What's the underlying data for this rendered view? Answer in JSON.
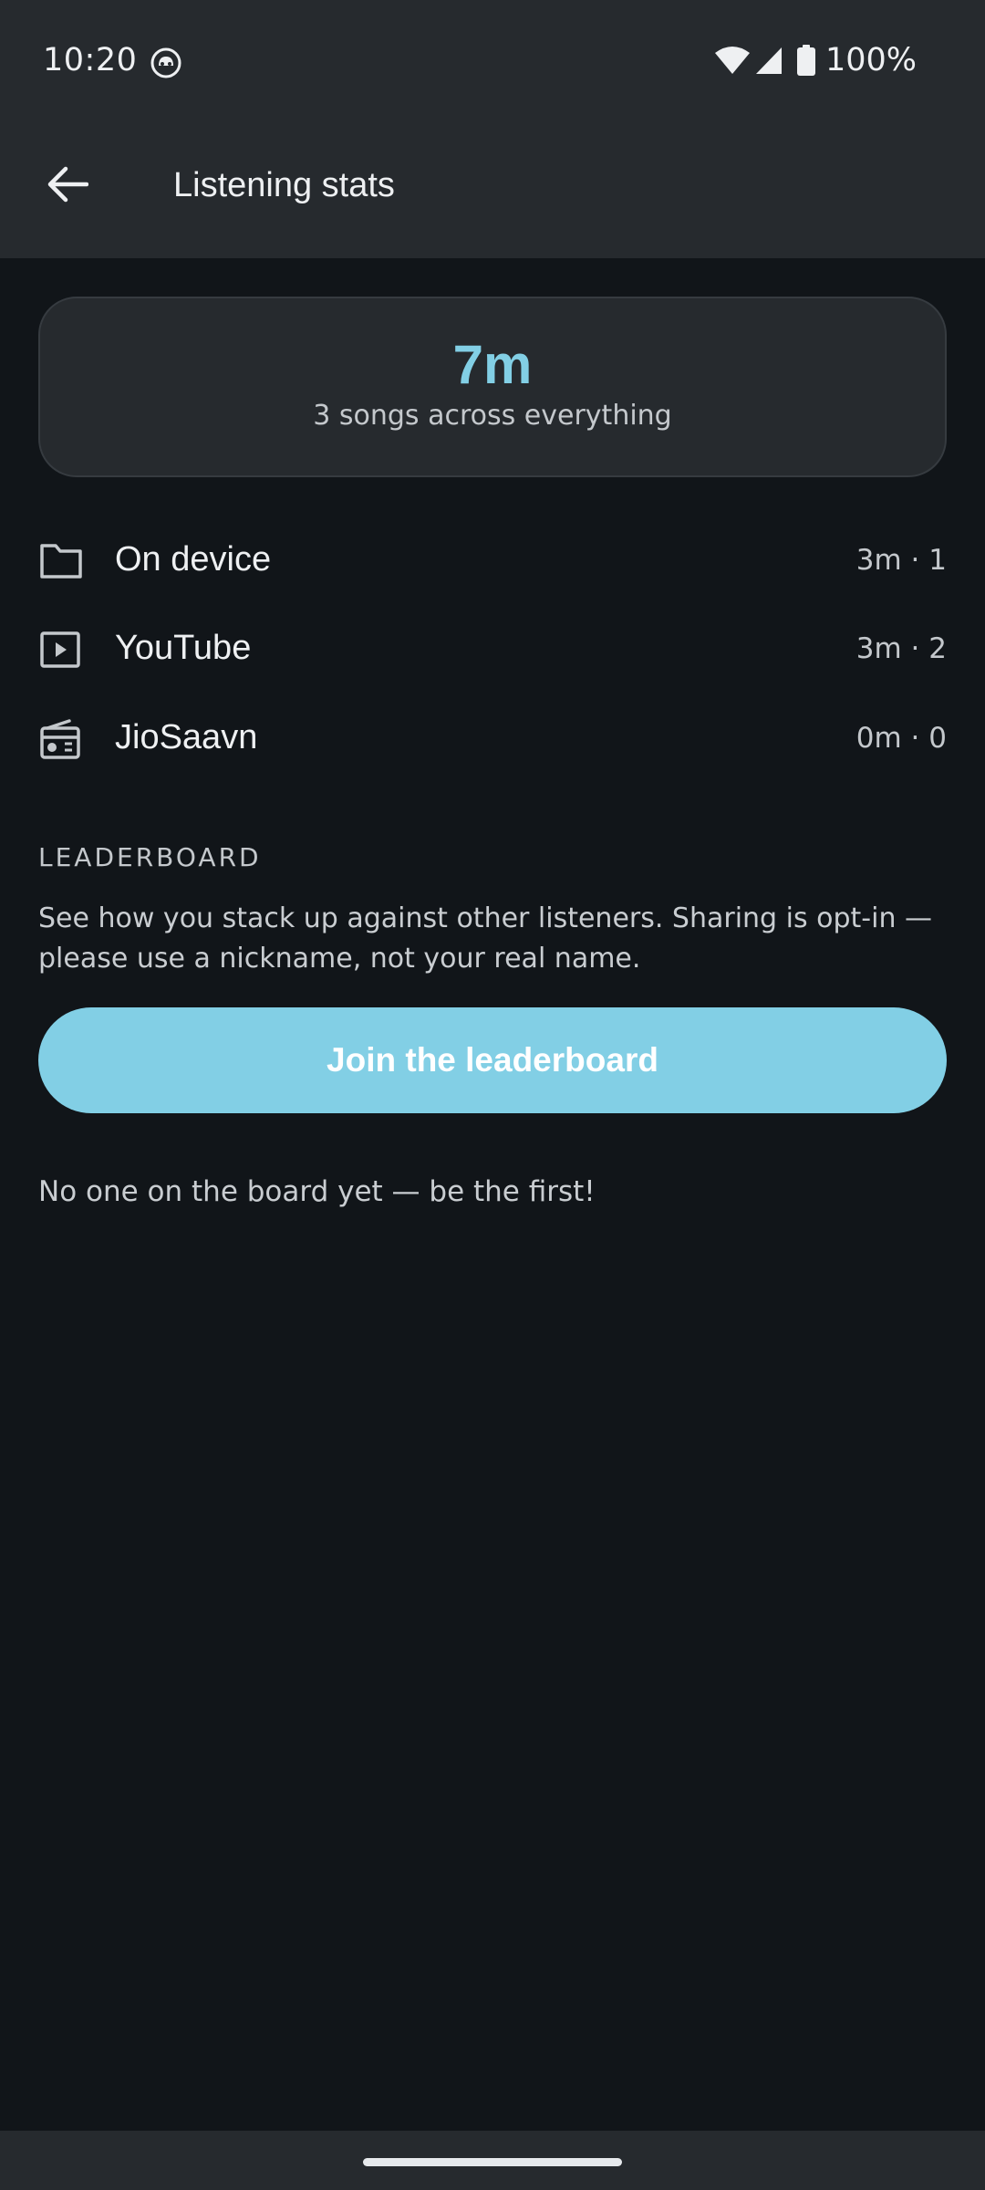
{
  "status_bar": {
    "time": "10:20",
    "battery": "100%"
  },
  "app_bar": {
    "title": "Listening stats"
  },
  "summary": {
    "value": "7m",
    "subtitle": "3 songs across everything"
  },
  "sources": [
    {
      "name": "On device",
      "stat": "3m · 1",
      "icon": "folder-icon"
    },
    {
      "name": "YouTube",
      "stat": "3m · 2",
      "icon": "play-box-icon"
    },
    {
      "name": "JioSaavn",
      "stat": "0m · 0",
      "icon": "radio-icon"
    }
  ],
  "leaderboard": {
    "heading": "LEADERBOARD",
    "description": "See how you stack up against other listeners. Sharing is opt-in — please use a nickname, not your real name.",
    "join_label": "Join the leaderboard",
    "empty_text": "No one on the board yet — be the first!"
  },
  "colors": {
    "accent": "#82cfe5",
    "background": "#111519",
    "surface": "#262a2e"
  }
}
